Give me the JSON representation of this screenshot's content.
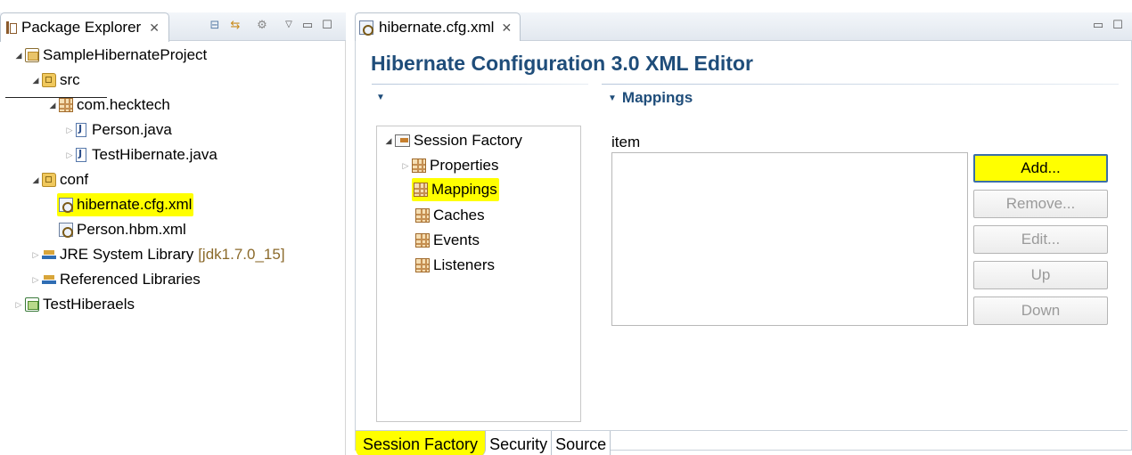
{
  "package_explorer": {
    "tab_label": "Package Explorer",
    "close_glyph": "✕",
    "toolbar": [
      "collapse-all-icon",
      "link-with-editor-icon",
      "filters-icon",
      "view-menu-icon",
      "minimize-icon",
      "maximize-icon"
    ],
    "tree": [
      {
        "label": "SampleHibernateProject",
        "icon": "project-icon"
      },
      {
        "label": "src",
        "icon": "source-folder-icon"
      },
      {
        "label": "com.hecktech",
        "icon": "package-icon"
      },
      {
        "label": "Person.java",
        "icon": "java-file-icon"
      },
      {
        "label": "TestHibernate.java",
        "icon": "java-file-icon"
      },
      {
        "label": "conf",
        "icon": "folder-icon"
      },
      {
        "label": "hibernate.cfg.xml",
        "icon": "xml-file-icon",
        "highlighted": true
      },
      {
        "label": "Person.hbm.xml",
        "icon": "xml-file-icon"
      },
      {
        "label": "JRE System Library",
        "decoration": "[jdk1.7.0_15]",
        "icon": "library-icon"
      },
      {
        "label": "Referenced Libraries",
        "icon": "library-icon"
      },
      {
        "label": "TestHiberaels",
        "icon": "project-icon"
      }
    ]
  },
  "editor": {
    "tab_label": "hibernate.cfg.xml",
    "close_glyph": "✕",
    "title": "Hibernate Configuration 3.0 XML Editor",
    "mappings_section": "Mappings",
    "session_tree": {
      "root": "Session Factory",
      "children": [
        "Properties",
        "Mappings",
        "Caches",
        "Events",
        "Listeners"
      ]
    },
    "item_label": "item",
    "buttons": [
      {
        "label": "Add...",
        "enabled": true
      },
      {
        "label": "Remove...",
        "enabled": false
      },
      {
        "label": "Edit...",
        "enabled": false
      },
      {
        "label": "Up",
        "enabled": false
      },
      {
        "label": "Down",
        "enabled": false
      }
    ],
    "bottom_tabs": [
      "Session Factory",
      "Security",
      "Source"
    ],
    "active_bottom_tab": "Session Factory"
  },
  "colors": {
    "highlight": "#ffff00",
    "title_blue": "#1f4d7a",
    "decoration_brown": "#8b6a2b"
  }
}
